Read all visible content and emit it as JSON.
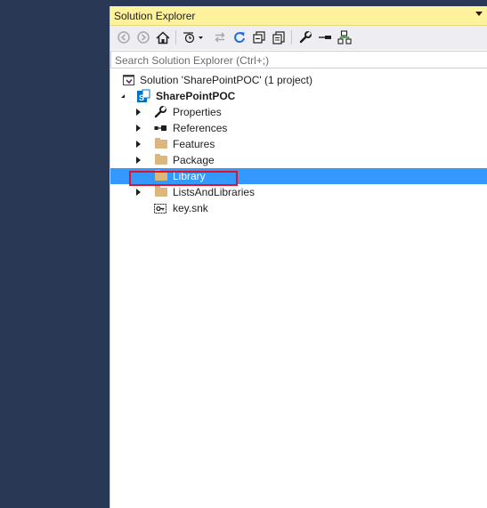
{
  "panel": {
    "title": "Solution Explorer"
  },
  "toolbar": {
    "buttons": [
      {
        "icon": "back-arrow-icon"
      },
      {
        "icon": "forward-arrow-icon"
      },
      {
        "icon": "home-icon"
      },
      {
        "icon": "pending-changes-filter-icon"
      },
      {
        "icon": "sync-with-document-icon"
      },
      {
        "icon": "refresh-icon"
      },
      {
        "icon": "collapse-all-icon"
      },
      {
        "icon": "show-all-files-icon"
      },
      {
        "icon": "properties-wrench-icon"
      },
      {
        "icon": "preview-selected-icon"
      },
      {
        "icon": "class-diagram-icon"
      }
    ]
  },
  "search": {
    "placeholder": "Search Solution Explorer (Ctrl+;)"
  },
  "tree": {
    "solution": {
      "label": "Solution 'SharePointPOC' (1 project)"
    },
    "project": {
      "label": "SharePointPOC"
    },
    "items": [
      {
        "label": "Properties",
        "icon": "wrench-icon",
        "expandable": true,
        "selected": false
      },
      {
        "label": "References",
        "icon": "references-icon",
        "expandable": true,
        "selected": false
      },
      {
        "label": "Features",
        "icon": "folder-icon",
        "expandable": true,
        "selected": false
      },
      {
        "label": "Package",
        "icon": "folder-icon",
        "expandable": true,
        "selected": false
      },
      {
        "label": "Library",
        "icon": "folder-icon",
        "expandable": false,
        "selected": true
      },
      {
        "label": "ListsAndLibraries",
        "icon": "folder-icon",
        "expandable": true,
        "selected": false
      },
      {
        "label": "key.snk",
        "icon": "key-file-icon",
        "expandable": false,
        "selected": false
      }
    ]
  },
  "colors": {
    "title_bar": "#fff29d",
    "selection": "#3399ff",
    "highlight_box": "#e81123",
    "outer_background": "#293955"
  }
}
